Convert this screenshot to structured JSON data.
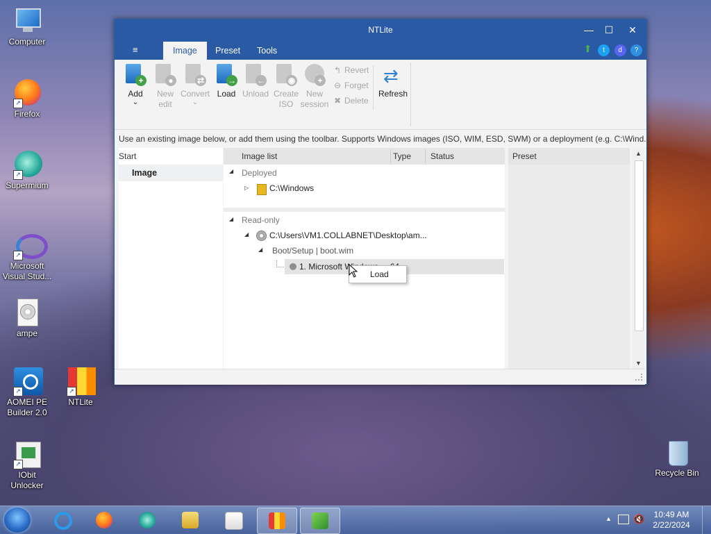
{
  "desktop": {
    "icons": [
      {
        "label": "Computer"
      },
      {
        "label": "Firefox"
      },
      {
        "label": "Supermium"
      },
      {
        "label": "Microsoft Visual Stud..."
      },
      {
        "label": "ampe"
      },
      {
        "label": "AOMEI PE Builder 2.0"
      },
      {
        "label": "NTLite"
      },
      {
        "label": "IObit Unlocker"
      },
      {
        "label": "Recycle Bin"
      }
    ]
  },
  "window": {
    "title": "NTLite",
    "controls": {
      "minimize": "—",
      "maximize": "☐",
      "close": "✕"
    },
    "menu": {
      "hamburger": "≡",
      "tabs": [
        "Image",
        "Preset",
        "Tools"
      ]
    },
    "ribbon": {
      "add": {
        "line1": "Add",
        "line2": "⌄"
      },
      "new_edit": {
        "line1": "New",
        "line2": "edit"
      },
      "convert": {
        "line1": "Convert",
        "line2": "⌄"
      },
      "load": {
        "line1": "Load"
      },
      "unload": {
        "line1": "Unload"
      },
      "create_iso": {
        "line1": "Create",
        "line2": "ISO"
      },
      "new_session": {
        "line1": "New",
        "line2": "session"
      },
      "revert": "Revert",
      "forget": "Forget",
      "delete": "Delete",
      "refresh": "Refresh"
    },
    "info_text": "Use an existing image below, or add them using the toolbar. Supports Windows images (ISO, WIM, ESD, SWM) or a deployment (e.g. C:\\Wind...",
    "left_pane": {
      "header": "Start",
      "item": "Image"
    },
    "image_list": {
      "columns": [
        "Image list",
        "Type",
        "Status"
      ],
      "deployed_group": "Deployed",
      "deployed_item": "C:\\Windows",
      "readonly_group": "Read-only",
      "readonly_path": "C:\\Users\\VM1.COLLABNET\\Desktop\\am...",
      "boot_setup": "Boot/Setup  |  boot.wim",
      "edition": "1. Microsoft Windows ... 64"
    },
    "preset_pane": {
      "header": "Preset"
    },
    "context_menu": {
      "items": [
        "Load"
      ]
    }
  },
  "taskbar": {
    "clock_time": "10:49 AM",
    "clock_date": "2/22/2024",
    "tray_arrow": "▲"
  }
}
